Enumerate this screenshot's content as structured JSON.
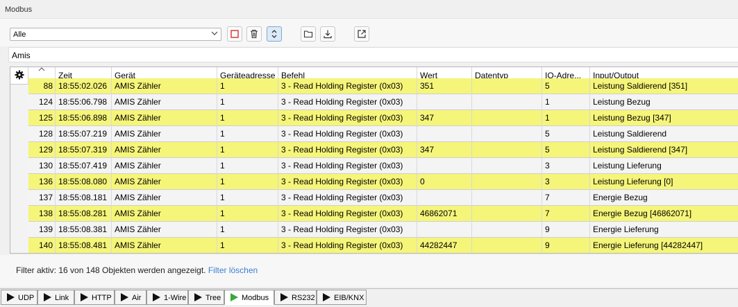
{
  "window": {
    "title": "Modbus"
  },
  "toolbar": {
    "filter_select_value": "Alle",
    "icons": [
      "stop-icon",
      "delete-icon",
      "autoscroll-icon",
      "open-folder-icon",
      "download-icon",
      "export-icon"
    ]
  },
  "subheader": {
    "title": "Amis"
  },
  "table": {
    "columns": [
      "Zeit",
      "Gerät",
      "Geräteadresse",
      "Befehl",
      "Wert",
      "Datentyp",
      "IO-Adre...",
      "Input/Output"
    ],
    "rows": [
      {
        "id": "88",
        "zeit": "18:55:02.026",
        "geraet": "AMIS Zähler",
        "adresse": "1",
        "befehl": "3 - Read Holding Register (0x03)",
        "wert": "351",
        "datentyp": "",
        "io": "5",
        "io_text": "Leistung Saldierend [351]",
        "highlight": true
      },
      {
        "id": "124",
        "zeit": "18:55:06.798",
        "geraet": "AMIS Zähler",
        "adresse": "1",
        "befehl": "3 - Read Holding Register (0x03)",
        "wert": "",
        "datentyp": "",
        "io": "1",
        "io_text": "Leistung Bezug",
        "highlight": false
      },
      {
        "id": "125",
        "zeit": "18:55:06.898",
        "geraet": "AMIS Zähler",
        "adresse": "1",
        "befehl": "3 - Read Holding Register (0x03)",
        "wert": "347",
        "datentyp": "",
        "io": "1",
        "io_text": "Leistung Bezug [347]",
        "highlight": true
      },
      {
        "id": "128",
        "zeit": "18:55:07.219",
        "geraet": "AMIS Zähler",
        "adresse": "1",
        "befehl": "3 - Read Holding Register (0x03)",
        "wert": "",
        "datentyp": "",
        "io": "5",
        "io_text": "Leistung Saldierend",
        "highlight": false
      },
      {
        "id": "129",
        "zeit": "18:55:07.319",
        "geraet": "AMIS Zähler",
        "adresse": "1",
        "befehl": "3 - Read Holding Register (0x03)",
        "wert": "347",
        "datentyp": "",
        "io": "5",
        "io_text": "Leistung Saldierend [347]",
        "highlight": true
      },
      {
        "id": "130",
        "zeit": "18:55:07.419",
        "geraet": "AMIS Zähler",
        "adresse": "1",
        "befehl": "3 - Read Holding Register (0x03)",
        "wert": "",
        "datentyp": "",
        "io": "3",
        "io_text": "Leistung Lieferung",
        "highlight": false
      },
      {
        "id": "136",
        "zeit": "18:55:08.080",
        "geraet": "AMIS Zähler",
        "adresse": "1",
        "befehl": "3 - Read Holding Register (0x03)",
        "wert": "0",
        "datentyp": "",
        "io": "3",
        "io_text": "Leistung Lieferung [0]",
        "highlight": true
      },
      {
        "id": "137",
        "zeit": "18:55:08.181",
        "geraet": "AMIS Zähler",
        "adresse": "1",
        "befehl": "3 - Read Holding Register (0x03)",
        "wert": "",
        "datentyp": "",
        "io": "7",
        "io_text": "Energie Bezug",
        "highlight": false
      },
      {
        "id": "138",
        "zeit": "18:55:08.281",
        "geraet": "AMIS Zähler",
        "adresse": "1",
        "befehl": "3 - Read Holding Register (0x03)",
        "wert": "46862071",
        "datentyp": "",
        "io": "7",
        "io_text": "Energie Bezug [46862071]",
        "highlight": true
      },
      {
        "id": "139",
        "zeit": "18:55:08.381",
        "geraet": "AMIS Zähler",
        "adresse": "1",
        "befehl": "3 - Read Holding Register (0x03)",
        "wert": "",
        "datentyp": "",
        "io": "9",
        "io_text": "Energie Lieferung",
        "highlight": false
      },
      {
        "id": "140",
        "zeit": "18:55:08.481",
        "geraet": "AMIS Zähler",
        "adresse": "1",
        "befehl": "3 - Read Holding Register (0x03)",
        "wert": "44282447",
        "datentyp": "",
        "io": "9",
        "io_text": "Energie Lieferung [44282447]",
        "highlight": true
      }
    ]
  },
  "status": {
    "text": "Filter aktiv: 16 von 148 Objekten werden angezeigt.",
    "link": "Filter löschen"
  },
  "tabs": [
    {
      "label": "UDP",
      "active": false
    },
    {
      "label": "Link",
      "active": false
    },
    {
      "label": "HTTP",
      "active": false
    },
    {
      "label": "Air",
      "active": false
    },
    {
      "label": "1-Wire",
      "active": false
    },
    {
      "label": "Tree",
      "active": false
    },
    {
      "label": "Modbus",
      "active": true
    },
    {
      "label": "RS232",
      "active": false
    },
    {
      "label": "EIB/KNX",
      "active": false
    }
  ],
  "colors": {
    "highlight_row": "#f5f57a",
    "link": "#3a7fd0",
    "active_tab_icon": "#39a93a",
    "stop_icon": "#d93030"
  }
}
